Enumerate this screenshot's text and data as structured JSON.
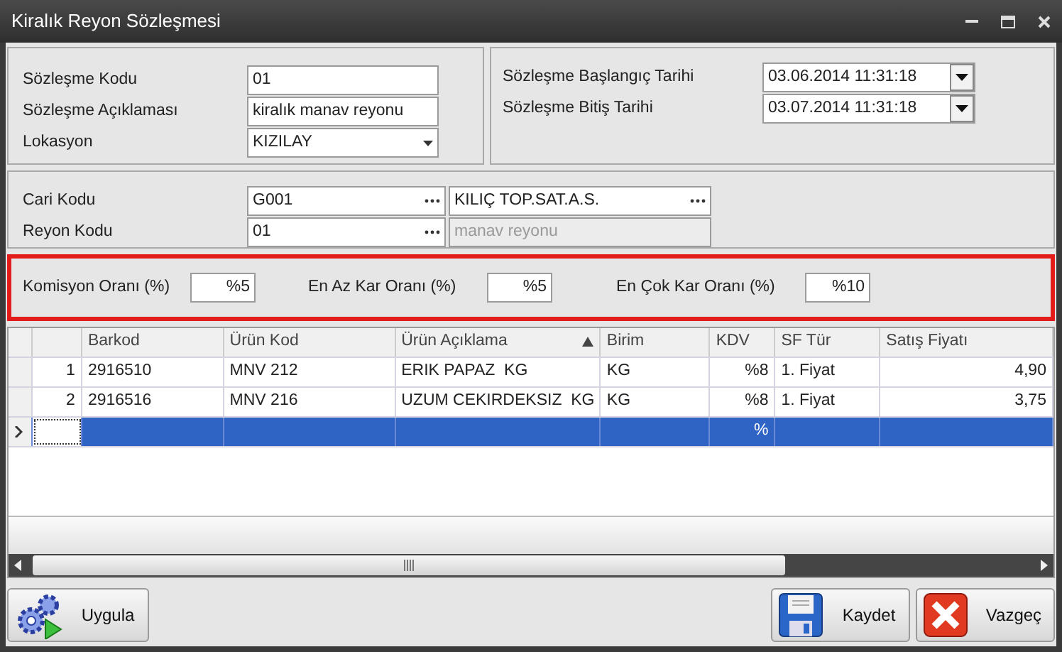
{
  "window": {
    "title": "Kiralık Reyon Sözleşmesi"
  },
  "contract": {
    "fields": [
      {
        "label": "Sözleşme Kodu",
        "value": "01",
        "kind": "text"
      },
      {
        "label": "Sözleşme Açıklaması",
        "value": "kiralık manav reyonu",
        "kind": "text"
      },
      {
        "label": "Lokasyon",
        "value": "KIZILAY",
        "kind": "combo"
      }
    ]
  },
  "dates": {
    "fields": [
      {
        "label": "Sözleşme Başlangıç Tarihi",
        "value": "03.06.2014 11:31:18",
        "kind": "date"
      },
      {
        "label": "Sözleşme Bitiş Tarihi",
        "value": "03.07.2014 11:31:18",
        "kind": "date"
      }
    ]
  },
  "account": {
    "rows": [
      {
        "label": "Cari Kodu",
        "code": "G001",
        "name": "KILIÇ TOP.SAT.A.S.",
        "name_disabled": false
      },
      {
        "label": "Reyon Kodu",
        "code": "01",
        "name": "manav reyonu",
        "name_disabled": true
      }
    ]
  },
  "rates": [
    {
      "label": "Komisyon Oranı (%)",
      "value": "%5"
    },
    {
      "label": "En Az Kar Oranı (%)",
      "value": "%5"
    },
    {
      "label": "En Çok Kar Oranı (%)",
      "value": "%10"
    }
  ],
  "table": {
    "columns": [
      {
        "label": "Barkod",
        "sorted": false,
        "kind": "text"
      },
      {
        "label": "Ürün Kod",
        "sorted": false,
        "kind": "text"
      },
      {
        "label": "Ürün Açıklama",
        "sorted": true,
        "kind": "text"
      },
      {
        "label": "Birim",
        "sorted": false,
        "kind": "text"
      },
      {
        "label": "KDV",
        "sorted": false,
        "kind": "number"
      },
      {
        "label": "SF Tür",
        "sorted": false,
        "kind": "text"
      },
      {
        "label": "Satış Fiyatı",
        "sorted": false,
        "kind": "number"
      }
    ],
    "rows": [
      {
        "number": "1",
        "selected": false,
        "cells": [
          "2916510",
          "MNV 212",
          "ERIK PAPAZ  KG",
          "KG",
          "%8",
          "1. Fiyat",
          "4,90"
        ]
      },
      {
        "number": "2",
        "selected": false,
        "cells": [
          "2916516",
          "MNV 216",
          "UZUM CEKIRDEKSIZ  KG",
          "KG",
          "%8",
          "1. Fiyat",
          "3,75"
        ]
      },
      {
        "selected": true,
        "cells": [
          "",
          "",
          "",
          "",
          "%",
          "",
          ""
        ]
      }
    ]
  },
  "buttons": [
    {
      "label": "Uygula",
      "kind": "apply"
    },
    {
      "label": "Kaydet",
      "kind": "save"
    },
    {
      "label": "Vazgeç",
      "kind": "cancel"
    }
  ]
}
